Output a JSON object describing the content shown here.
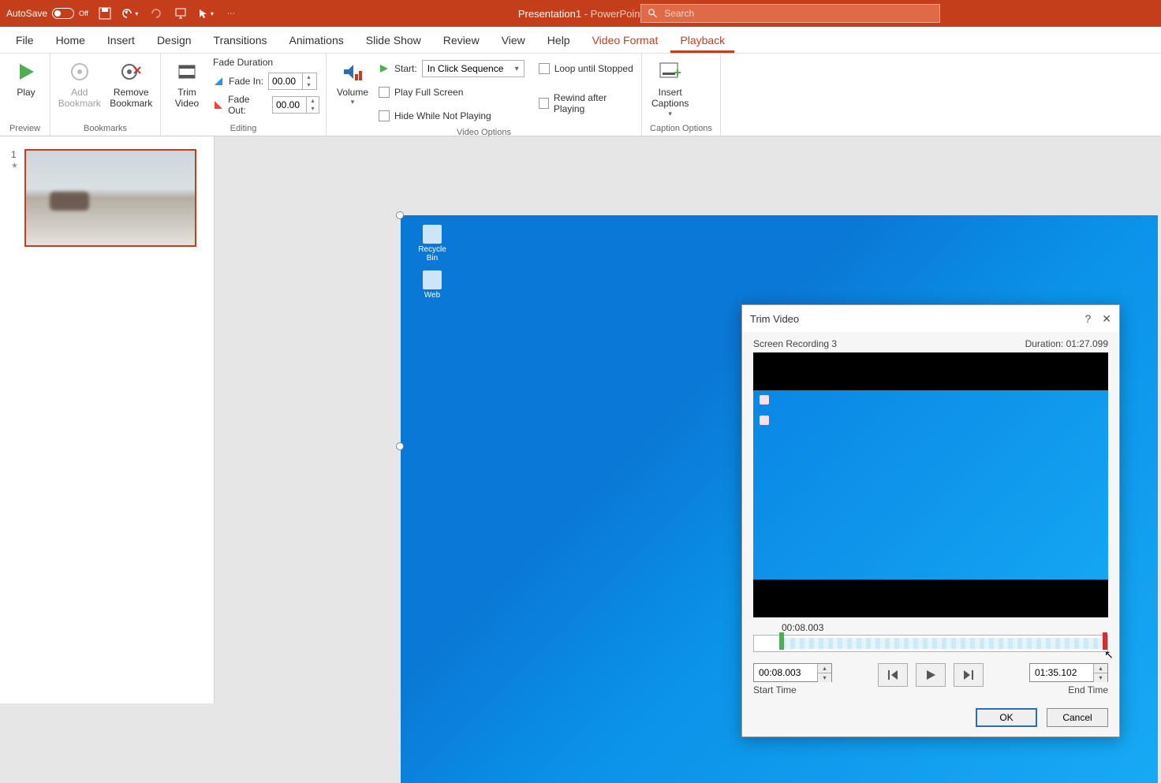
{
  "titlebar": {
    "autosave_label": "AutoSave",
    "autosave_state": "Off",
    "doc_name": "Presentation1",
    "app_name": "PowerPoint",
    "separator": " - ",
    "search_placeholder": "Search"
  },
  "tabs": {
    "file": "File",
    "home": "Home",
    "insert": "Insert",
    "design": "Design",
    "transitions": "Transitions",
    "animations": "Animations",
    "slideshow": "Slide Show",
    "review": "Review",
    "view": "View",
    "help": "Help",
    "video_format": "Video Format",
    "playback": "Playback"
  },
  "ribbon": {
    "preview": {
      "play": "Play",
      "group": "Preview"
    },
    "bookmarks": {
      "add": "Add\nBookmark",
      "remove": "Remove\nBookmark",
      "group": "Bookmarks"
    },
    "editing": {
      "trim": "Trim\nVideo",
      "fade_duration": "Fade Duration",
      "fade_in": "Fade In:",
      "fade_in_val": "00.00",
      "fade_out": "Fade Out:",
      "fade_out_val": "00.00",
      "group": "Editing"
    },
    "video_options": {
      "volume": "Volume",
      "start": "Start:",
      "start_val": "In Click Sequence",
      "full_screen": "Play Full Screen",
      "hide": "Hide While Not Playing",
      "loop": "Loop until Stopped",
      "rewind": "Rewind after Playing",
      "group": "Video Options"
    },
    "captions": {
      "insert": "Insert\nCaptions",
      "group": "Caption Options"
    }
  },
  "slidepanel": {
    "num": "1"
  },
  "desktop": {
    "recycle": "Recycle Bin",
    "web": "Web"
  },
  "dialog": {
    "title": "Trim Video",
    "clip_name": "Screen Recording 3",
    "duration_label": "Duration:",
    "duration_val": "01:27.099",
    "current_time": "00:08.003",
    "start_time_val": "00:08.003",
    "start_time_label": "Start Time",
    "end_time_val": "01:35.102",
    "end_time_label": "End Time",
    "ok": "OK",
    "cancel": "Cancel"
  }
}
